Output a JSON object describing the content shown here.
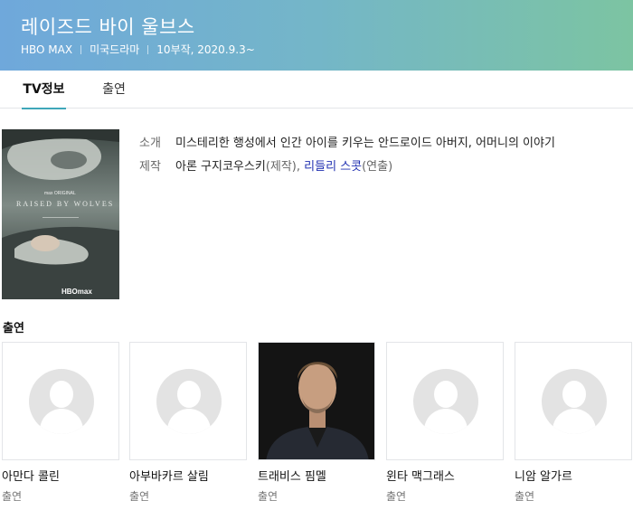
{
  "header": {
    "title": "레이즈드 바이 울브스",
    "meta": [
      "HBO MAX",
      "미국드라마",
      "10부작, 2020.9.3~"
    ],
    "gradient_start": "#6fa8db",
    "gradient_end": "#7cc4a2"
  },
  "tabs": [
    {
      "label": "TV정보",
      "active": true
    },
    {
      "label": "출연",
      "active": false
    }
  ],
  "poster": {
    "top_brand": "max ORIGINAL",
    "title": "RAISED BY WOLVES",
    "bottom_brand": "HBOmax"
  },
  "info": {
    "intro_label": "소개",
    "intro_text": "미스테리한 행성에서 인간 아이를 키우는 안드로이드 아버지, 어머니의 이야기",
    "credit_label": "제작",
    "producer": "아론 구지코우스키",
    "producer_role": "(제작), ",
    "director": "리들리 스콧",
    "director_role": "(연출)"
  },
  "cast_section": {
    "title": "출연"
  },
  "cast": [
    {
      "name": "아만다 콜린",
      "role": "출연",
      "image": "placeholder"
    },
    {
      "name": "아부바카르 살림",
      "role": "출연",
      "image": "placeholder"
    },
    {
      "name": "트래비스 핌멜",
      "role": "출연",
      "image": "photo"
    },
    {
      "name": "윈타 맥그래스",
      "role": "출연",
      "image": "placeholder"
    },
    {
      "name": "니암 알가르",
      "role": "출연",
      "image": "placeholder"
    }
  ],
  "colors": {
    "accent": "#3fa7b9",
    "link": "#1f2fb0"
  }
}
